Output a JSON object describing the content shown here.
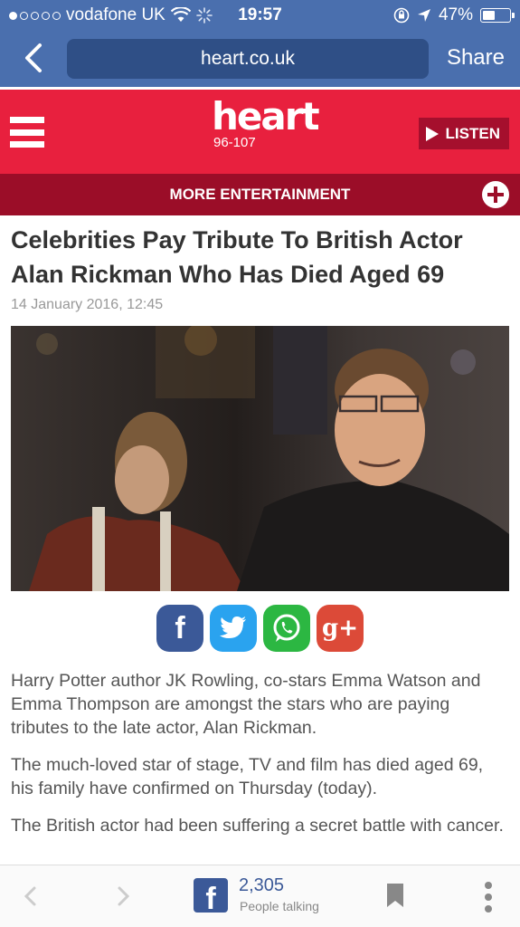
{
  "status_bar": {
    "carrier": "vodafone UK",
    "time": "19:57",
    "battery": "47%"
  },
  "browser": {
    "url": "heart.co.uk",
    "share_label": "Share"
  },
  "header": {
    "logo_word": "heart",
    "logo_frequency": "96-107",
    "listen_label": "LISTEN"
  },
  "section_bar": {
    "label": "MORE ENTERTAINMENT"
  },
  "article": {
    "headline": "Celebrities Pay Tribute To British Actor Alan Rickman Who Has Died Aged 69",
    "date": "14 January 2016, 12:45",
    "paragraphs": [
      "Harry Potter author JK Rowling, co-stars Emma Watson and Emma Thompson are amongst the stars who are paying tributes to the late actor, Alan Rickman.",
      "The much-loved star of stage, TV and film has died aged 69, his family have confirmed on Thursday (today).",
      "The British actor had been suffering a secret battle with cancer."
    ]
  },
  "social_share": {
    "facebook_glyph": "f",
    "googleplus_glyph": "g+"
  },
  "bottom_bar": {
    "share_count": "2,305",
    "share_caption": "People talking"
  },
  "colors": {
    "ios_bar": "#4a6fae",
    "heart_red": "#e8203e",
    "heart_dark_red": "#9b0d28",
    "facebook": "#3b5998",
    "twitter": "#2aa3ef",
    "whatsapp": "#2cb742",
    "googleplus": "#dc4a38"
  }
}
